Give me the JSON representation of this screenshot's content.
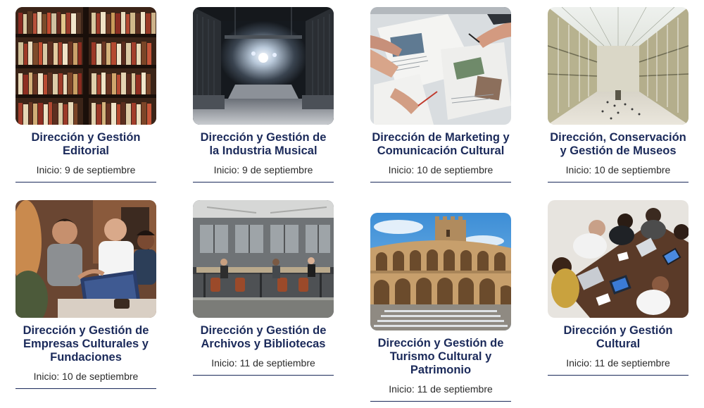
{
  "courses": [
    {
      "title": "Dirección y Gestión Editorial",
      "start": "Inicio: 9 de septiembre",
      "image": "bookshelf-library-photo"
    },
    {
      "title": "Dirección y Gestión de la Industria Musical",
      "start": "Inicio: 9 de septiembre",
      "image": "concert-stage-photo"
    },
    {
      "title": "Dirección de Marketing y Comunicación Cultural",
      "start": "Inicio: 10 de septiembre",
      "image": "marketing-meeting-photo"
    },
    {
      "title": "Dirección, Conservación y Gestión de Museos",
      "start": "Inicio: 10 de septiembre",
      "image": "museum-atrium-photo"
    },
    {
      "title": "Dirección y Gestión de Empresas Culturales y Fundaciones",
      "start": "Inicio: 10 de septiembre",
      "image": "team-laptop-photo"
    },
    {
      "title": "Dirección y Gestión de Archivos y Bibliotecas",
      "start": "Inicio: 11 de septiembre",
      "image": "library-reading-room-photo"
    },
    {
      "title": "Dirección y Gestión de Turismo Cultural y Patrimonio",
      "start": "Inicio: 11 de septiembre",
      "image": "castle-courtyard-photo"
    },
    {
      "title": "Dirección y Gestión Cultural",
      "start": "Inicio: 11 de septiembre",
      "image": "team-table-overhead-photo"
    }
  ],
  "colors": {
    "title": "#1b2a5a",
    "rule": "#1b2a5a",
    "text": "#2b2b2b"
  }
}
